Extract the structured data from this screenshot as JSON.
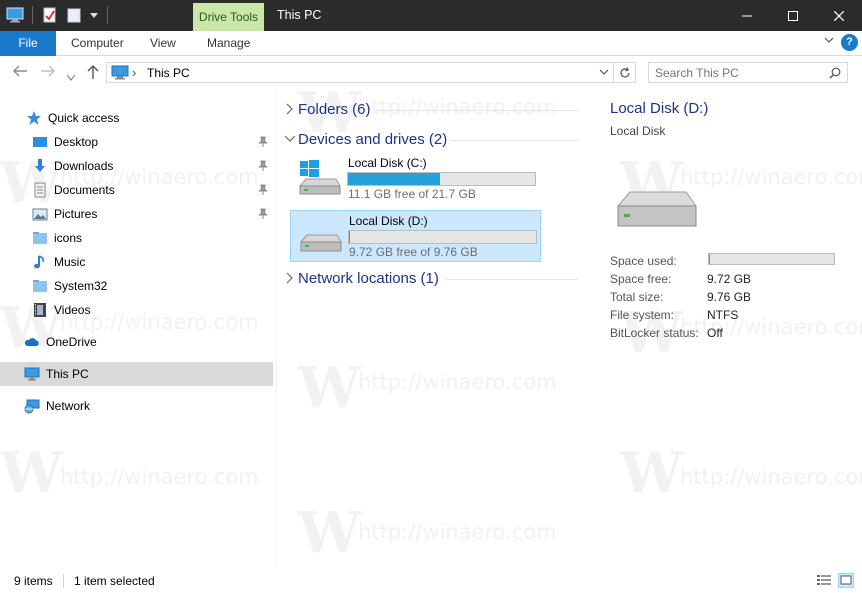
{
  "window": {
    "title": "This PC",
    "context_tab": "Drive Tools",
    "controls": {
      "minimize_icon": "minimize-icon",
      "maximize_icon": "maximize-icon",
      "close_icon": "close-icon"
    }
  },
  "ribbon": {
    "tabs": [
      "File",
      "Computer",
      "View",
      "Manage"
    ],
    "help_label": "?"
  },
  "address": {
    "path_icon": "this-pc-icon",
    "separator": "›",
    "location": "This PC",
    "search_placeholder": "Search This PC"
  },
  "navpane": {
    "items": [
      {
        "label": "Quick access",
        "icon": "star-icon"
      },
      {
        "label": "Desktop",
        "icon": "desktop-icon",
        "pinned": true
      },
      {
        "label": "Downloads",
        "icon": "downloads-icon",
        "pinned": true
      },
      {
        "label": "Documents",
        "icon": "documents-icon",
        "pinned": true
      },
      {
        "label": "Pictures",
        "icon": "pictures-icon",
        "pinned": true
      },
      {
        "label": "icons",
        "icon": "folder-icon"
      },
      {
        "label": "Music",
        "icon": "music-icon"
      },
      {
        "label": "System32",
        "icon": "folder-icon"
      },
      {
        "label": "Videos",
        "icon": "videos-icon"
      },
      {
        "label": "OneDrive",
        "icon": "onedrive-icon"
      },
      {
        "label": "This PC",
        "icon": "this-pc-icon",
        "selected": true
      },
      {
        "label": "Network",
        "icon": "network-icon"
      }
    ]
  },
  "content": {
    "groups": [
      {
        "label": "Folders (6)",
        "expanded": false
      },
      {
        "label": "Devices and drives (2)",
        "expanded": true
      },
      {
        "label": "Network locations (1)",
        "expanded": false
      }
    ],
    "drives": [
      {
        "name": "Local Disk (C:)",
        "free_text": "11.1 GB free of 21.7 GB",
        "used_fraction": 0.49,
        "selected": false
      },
      {
        "name": "Local Disk (D:)",
        "free_text": "9.72 GB free of 9.76 GB",
        "used_fraction": 0.004,
        "selected": true
      }
    ]
  },
  "details": {
    "title": "Local Disk (D:)",
    "subtitle": "Local Disk",
    "space_used_label": "Space used:",
    "space_used_fraction": 0.004,
    "properties": [
      {
        "label": "Space free:",
        "value": "9.72 GB"
      },
      {
        "label": "Total size:",
        "value": "9.76 GB"
      },
      {
        "label": "File system:",
        "value": "NTFS"
      },
      {
        "label": "BitLocker status:",
        "value": "Off"
      }
    ]
  },
  "status": {
    "item_count": "9 items",
    "selected": "1 item selected"
  },
  "watermark": {
    "text": "http://winaero.com",
    "letter": "W"
  },
  "colors": {
    "accent": "#1979ca",
    "context_tab": "#c9e7a7",
    "header_text": "#1e3287",
    "drive_bar": "#26a0da",
    "selection": "#cce8ff"
  }
}
